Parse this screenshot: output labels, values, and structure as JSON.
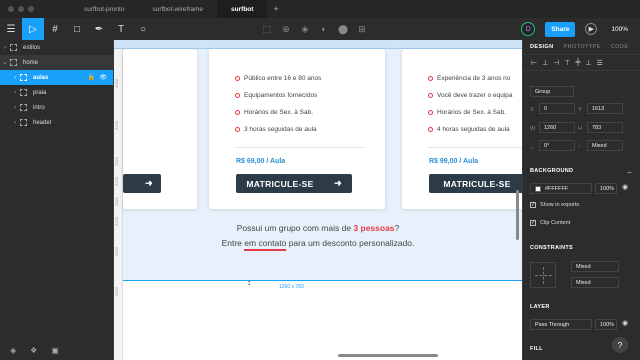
{
  "tabs": [
    {
      "label": "surfbot-pronto"
    },
    {
      "label": "surfbot-wireframe"
    },
    {
      "label": "surfbot"
    }
  ],
  "tab_add": "+",
  "toolbar": {
    "menu_icon": "☰",
    "move_icon": "▷",
    "frame_icon": "#",
    "shape_icon": "□",
    "pen_icon": "✒",
    "text_icon": "T",
    "comment_icon": "○",
    "mid_icons": [
      "⬚",
      "⊕",
      "◈",
      "◐",
      "⬤",
      "⊞"
    ],
    "avatar": "D",
    "share_label": "Share",
    "play_icon": "▶",
    "zoom": "100%"
  },
  "layers": [
    {
      "name": "estilos",
      "chev": "›",
      "type": "page"
    },
    {
      "name": "home",
      "chev": "⌄",
      "type": "page-open"
    },
    {
      "name": "aulas",
      "chev": "›",
      "type": "selected"
    },
    {
      "name": "praia",
      "chev": "›",
      "type": "child"
    },
    {
      "name": "intro",
      "chev": "›",
      "type": "child"
    },
    {
      "name": "header",
      "chev": "›",
      "type": "child"
    }
  ],
  "layer_actions": {
    "lock": "🔓",
    "eye": "👁"
  },
  "left_bottom_icons": [
    "◈",
    "❖",
    "▣"
  ],
  "ruler_left": [
    "3090",
    "3190",
    "3150",
    "3120",
    "3180",
    "3200",
    "3150",
    "3400"
  ],
  "cards": {
    "middle": {
      "features": [
        "Público entre 16 e 80 anos",
        "Equipamentos fornecidos",
        "Horários de Sex. à Sab.",
        "3 horas seguidas de aula"
      ],
      "price": "R$ 69,00 / Aula",
      "button": "MATRICULE-SE"
    },
    "right": {
      "features": [
        "Experiência de 3 anos no",
        "Você deve trazer o equipa",
        "Horários de Sex. à Sab.",
        "4 horas seguidas de aula"
      ],
      "price": "R$ 99,00 / Aula",
      "button": "MATRICULE-SE"
    },
    "arrow": "➜"
  },
  "cta": {
    "line1_pre": "Possui um grupo com mais de ",
    "line1_highlight": "3 pessoas",
    "line1_post": "?",
    "line2_pre": "Entre ",
    "line2_link": "em contato",
    "line2_post": " para um desconto personalizado."
  },
  "selection_dims": "1260 x 783",
  "right_panel": {
    "tabs": [
      "DESIGN",
      "PROTOTYPE",
      "CODE"
    ],
    "align_icons": [
      "⊢",
      "⊥",
      "⊣",
      "⊤",
      "╪",
      "⊥",
      "☰"
    ],
    "group": "Group",
    "x_label": "X",
    "x_value": "0",
    "y_label": "Y",
    "y_value": "1613",
    "w_label": "W",
    "w_value": "1260",
    "h_label": "H",
    "h_value": "783",
    "rotation": "0°",
    "radius": "Mixed",
    "background_title": "BACKGROUND",
    "fill_hex": "#FFFFFF",
    "fill_opacity": "100%",
    "show_exports": "Show in exports",
    "clip_content": "Clip Content",
    "constraints_title": "CONSTRAINTS",
    "constraint_h": "Mixed",
    "constraint_v": "Mixed",
    "layer_title": "LAYER",
    "blend": "Pass Through",
    "layer_opacity": "100%",
    "fill_title": "FILL",
    "check": "✓",
    "help": "?"
  }
}
